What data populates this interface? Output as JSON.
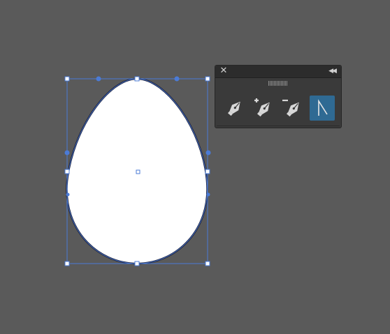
{
  "document": {
    "canvas_color": "#5a5a5a",
    "shape": "egg",
    "shape_fill": "#ffffff",
    "shape_stroke": "#1a1f3a",
    "selection_color": "#4b7bd6"
  },
  "pen_tools_panel": {
    "close_icon": "✕",
    "collapse_icon": "◀◀",
    "tools": [
      {
        "name": "pen-tool",
        "active": false
      },
      {
        "name": "add-anchor-point-tool",
        "active": false
      },
      {
        "name": "delete-anchor-point-tool",
        "active": false
      },
      {
        "name": "anchor-point-tool",
        "active": true
      }
    ],
    "active_color": "#2f6a93"
  }
}
